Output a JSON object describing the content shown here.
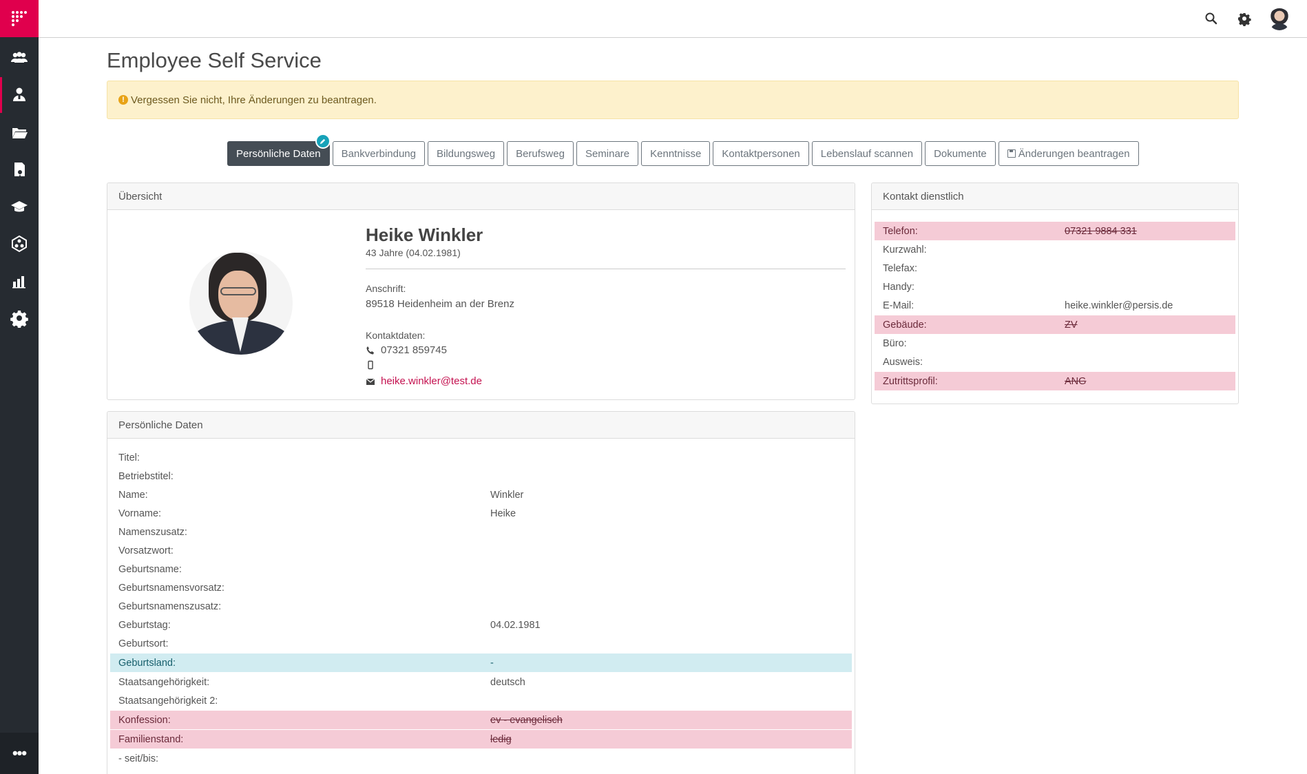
{
  "app": {
    "title": "Employee Self Service"
  },
  "alert": {
    "text": "Vergessen Sie nicht, Ihre Änderungen zu beantragen.",
    "icon": "warning-icon"
  },
  "tabs": [
    {
      "label": "Persönliche Daten",
      "active": true
    },
    {
      "label": "Bankverbindung"
    },
    {
      "label": "Bildungsweg"
    },
    {
      "label": "Berufsweg"
    },
    {
      "label": "Seminare"
    },
    {
      "label": "Kenntnisse"
    },
    {
      "label": "Kontaktpersonen"
    },
    {
      "label": "Lebenslauf scannen"
    },
    {
      "label": "Dokumente"
    },
    {
      "label": "Änderungen beantragen",
      "icon": "save-icon"
    }
  ],
  "overview": {
    "title": "Übersicht",
    "name": "Heike Winkler",
    "age": "43 Jahre (04.02.1981)",
    "address_label": "Anschrift:",
    "address": "89518 Heidenheim an der Brenz",
    "contact_label": "Kontaktdaten:",
    "phone": "07321 859745",
    "mobile": "",
    "email": "heike.winkler@test.de"
  },
  "contact": {
    "title": "Kontakt dienstlich",
    "rows": [
      {
        "label": "Telefon:",
        "value": "07321 9884 331",
        "state": "removed"
      },
      {
        "label": "Kurzwahl:",
        "value": ""
      },
      {
        "label": "Telefax:",
        "value": ""
      },
      {
        "label": "Handy:",
        "value": ""
      },
      {
        "label": "E-Mail:",
        "value": "heike.winkler@persis.de"
      },
      {
        "label": "Gebäude:",
        "value": "ZV",
        "state": "removed"
      },
      {
        "label": "Büro:",
        "value": ""
      },
      {
        "label": "Ausweis:",
        "value": ""
      },
      {
        "label": "Zutrittsprofil:",
        "value": "ANG",
        "state": "removed"
      }
    ]
  },
  "personal": {
    "title": "Persönliche Daten",
    "rows": [
      {
        "label": "Titel:",
        "value": ""
      },
      {
        "label": "Betriebstitel:",
        "value": ""
      },
      {
        "label": "Name:",
        "value": "Winkler"
      },
      {
        "label": "Vorname:",
        "value": "Heike"
      },
      {
        "label": "Namenszusatz:",
        "value": ""
      },
      {
        "label": "Vorsatzwort:",
        "value": ""
      },
      {
        "label": "Geburtsname:",
        "value": ""
      },
      {
        "label": "Geburtsnamensvorsatz:",
        "value": ""
      },
      {
        "label": "Geburtsnamenszusatz:",
        "value": ""
      },
      {
        "label": "Geburtstag:",
        "value": "04.02.1981"
      },
      {
        "label": "Geburtsort:",
        "value": ""
      },
      {
        "label": "Geburtsland:",
        "value": "-",
        "state": "changed"
      },
      {
        "label": "Staatsangehörigkeit:",
        "value": "deutsch"
      },
      {
        "label": "Staatsangehörigkeit 2:",
        "value": ""
      },
      {
        "label": "Konfession:",
        "value": "ev - evangelisch",
        "state": "removed"
      },
      {
        "label": "Familienstand:",
        "value": "ledig",
        "state": "removed"
      },
      {
        "label": "- seit/bis:",
        "value": ""
      }
    ]
  },
  "colors": {
    "brand": "#e0004d",
    "sidebar": "#262b31",
    "removed": "#f5cbd6",
    "changed": "#d1ecf1",
    "link": "#c41250"
  }
}
